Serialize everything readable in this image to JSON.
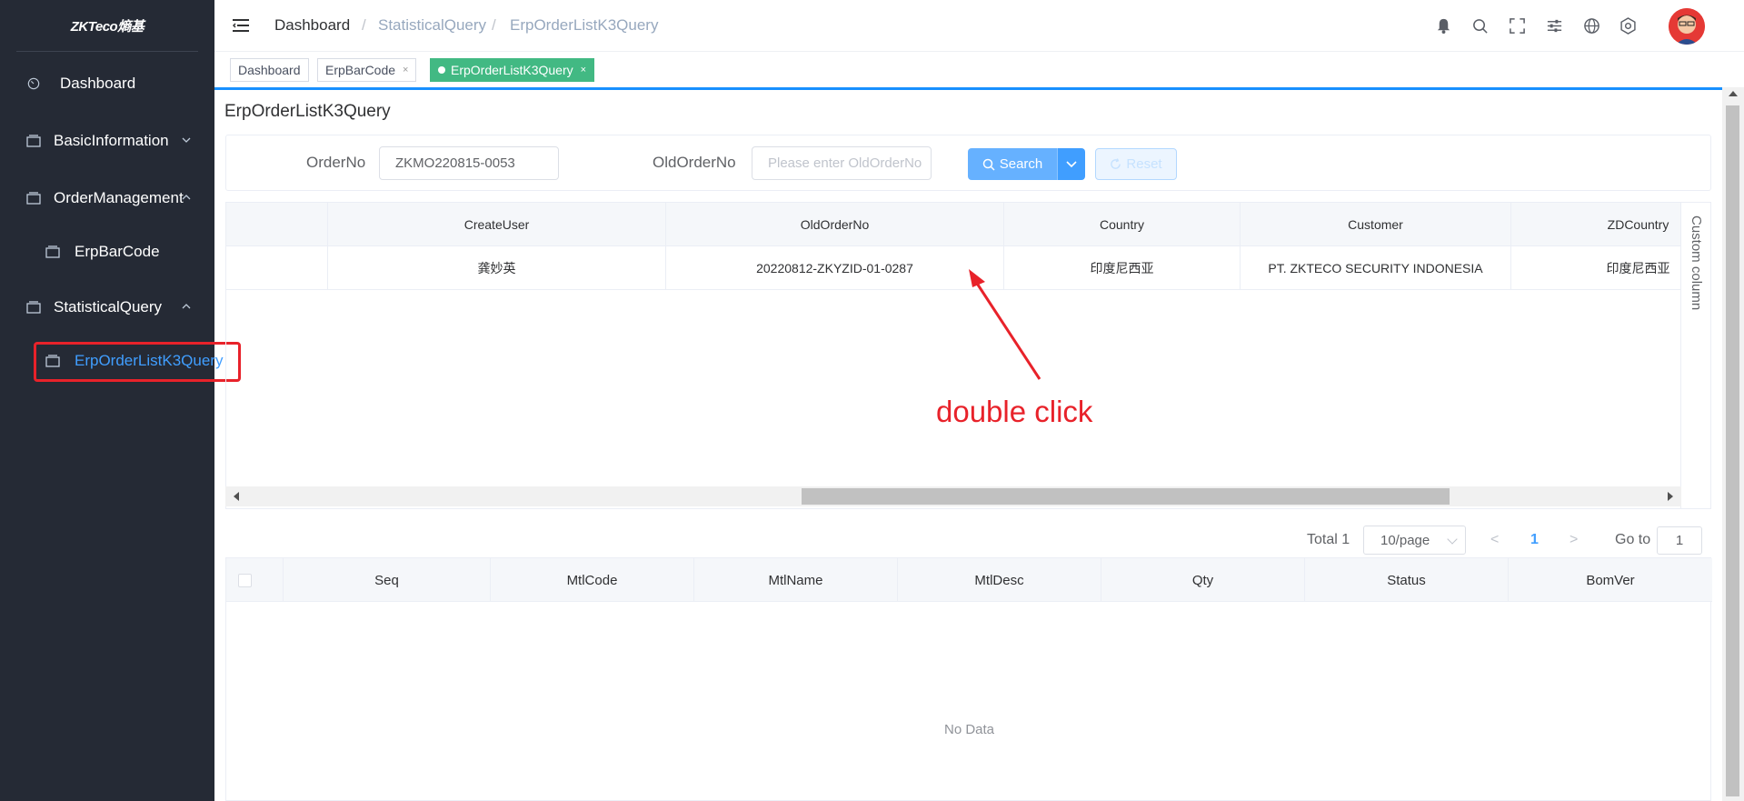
{
  "sidebar": {
    "logo": "ZKTeco熵基",
    "items": [
      {
        "label": "Dashboard",
        "icon": "dashboard-icon"
      },
      {
        "label": "BasicInformation",
        "icon": "folder-icon",
        "expand": "chevron-down-icon"
      },
      {
        "label": "OrderManagement",
        "icon": "folder-icon",
        "expand": "chevron-up-icon"
      },
      {
        "label": "ErpBarCode",
        "icon": "folder-icon"
      },
      {
        "label": "StatisticalQuery",
        "icon": "folder-icon",
        "expand": "chevron-up-icon"
      },
      {
        "label": "ErpOrderListK3Query",
        "icon": "folder-icon",
        "active": true
      }
    ]
  },
  "header": {
    "breadcrumb": [
      "Dashboard",
      "StatisticalQuery",
      "ErpOrderListK3Query"
    ],
    "separator": "/",
    "icons": [
      "bell-icon",
      "search-icon",
      "fullscreen-icon",
      "sliders-icon",
      "globe-icon",
      "settings-icon"
    ]
  },
  "tags": [
    {
      "label": "Dashboard"
    },
    {
      "label": "ErpBarCode",
      "close": "×"
    },
    {
      "label": "ErpOrderListK3Query",
      "close": "×",
      "active": true
    }
  ],
  "page": {
    "title": "ErpOrderListK3Query"
  },
  "filters": {
    "order_no_label": "OrderNo",
    "order_no_value": "ZKMO220815-0053",
    "old_order_no_label": "OldOrderNo",
    "old_order_no_placeholder": "Please enter OldOrderNo",
    "search_label": "Search",
    "reset_label": "Reset"
  },
  "upper_table": {
    "columns": [
      "",
      "CreateUser",
      "OldOrderNo",
      "Country",
      "Customer",
      "ZDCountry"
    ],
    "rows": [
      [
        "",
        "龚妙英",
        "20220812-ZKYZID-01-0287",
        "印度尼西亚",
        "PT. ZKTECO SECURITY INDONESIA",
        "印度尼西亚"
      ]
    ],
    "custom_column_label": "Custom column"
  },
  "annotation": {
    "text": "double click",
    "color": "#e8222a"
  },
  "pagination": {
    "total_text": "Total 1",
    "page_size": "10/page",
    "current_page": "1",
    "prev": "<",
    "next": ">",
    "goto_label": "Go to",
    "goto_value": "1"
  },
  "lower_table": {
    "columns": [
      "Seq",
      "MtlCode",
      "MtlName",
      "MtlDesc",
      "Qty",
      "Status",
      "BomVer"
    ],
    "empty_text": "No Data"
  },
  "colors": {
    "sidebar_bg": "#252a35",
    "accent": "#409eff",
    "tag_active": "#42b983",
    "highlight": "#e8222a"
  }
}
